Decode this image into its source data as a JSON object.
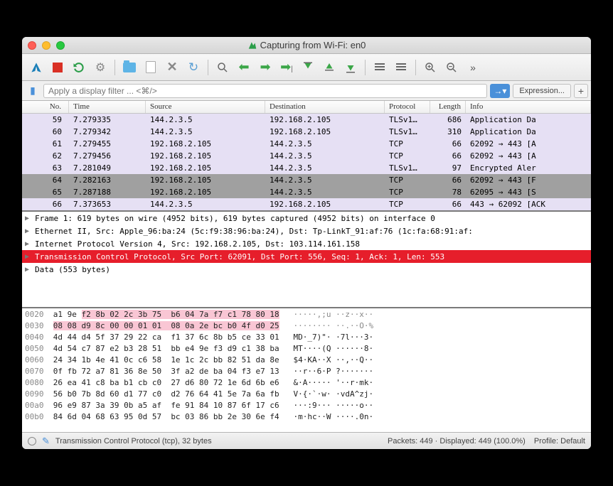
{
  "window": {
    "title": "Capturing from Wi-Fi: en0"
  },
  "filter": {
    "placeholder": "Apply a display filter ... <⌘/>",
    "expression_label": "Expression..."
  },
  "columns": {
    "no": "No.",
    "time": "Time",
    "src": "Source",
    "dst": "Destination",
    "proto": "Protocol",
    "len": "Length",
    "info": "Info"
  },
  "packets": [
    {
      "no": "59",
      "time": "7.279335",
      "src": "144.2.3.5",
      "dst": "192.168.2.105",
      "proto": "TLSv1…",
      "len": "686",
      "info": "Application Da",
      "bg": "#e6e0f4"
    },
    {
      "no": "60",
      "time": "7.279342",
      "src": "144.2.3.5",
      "dst": "192.168.2.105",
      "proto": "TLSv1…",
      "len": "310",
      "info": "Application Da",
      "bg": "#e6e0f4"
    },
    {
      "no": "61",
      "time": "7.279455",
      "src": "192.168.2.105",
      "dst": "144.2.3.5",
      "proto": "TCP",
      "len": "66",
      "info": "62092 → 443  [A",
      "bg": "#e6e0f4"
    },
    {
      "no": "62",
      "time": "7.279456",
      "src": "192.168.2.105",
      "dst": "144.2.3.5",
      "proto": "TCP",
      "len": "66",
      "info": "62092 → 443  [A",
      "bg": "#e6e0f4"
    },
    {
      "no": "63",
      "time": "7.281049",
      "src": "192.168.2.105",
      "dst": "144.2.3.5",
      "proto": "TLSv1…",
      "len": "97",
      "info": "Encrypted Aler",
      "bg": "#e6e0f4"
    },
    {
      "no": "64",
      "time": "7.282163",
      "src": "192.168.2.105",
      "dst": "144.2.3.5",
      "proto": "TCP",
      "len": "66",
      "info": "62092 → 443  [F",
      "bg": "#a0a0a0"
    },
    {
      "no": "65",
      "time": "7.287188",
      "src": "192.168.2.105",
      "dst": "144.2.3.5",
      "proto": "TCP",
      "len": "78",
      "info": "62095 → 443  [S",
      "bg": "#a0a0a0"
    },
    {
      "no": "66",
      "time": "7.373653",
      "src": "144.2.3.5",
      "dst": "192.168.2.105",
      "proto": "TCP",
      "len": "66",
      "info": "443 → 62092  [ACK",
      "bg": "#e6e0f4"
    }
  ],
  "details": [
    {
      "text": "Frame 1: 619 bytes on wire (4952 bits), 619 bytes captured (4952 bits) on interface 0",
      "sel": false
    },
    {
      "text": "Ethernet II, Src: Apple_96:ba:24 (5c:f9:38:96:ba:24), Dst: Tp-LinkT_91:af:76 (1c:fa:68:91:af:",
      "sel": false
    },
    {
      "text": "Internet Protocol Version 4, Src: 192.168.2.105, Dst: 103.114.161.158",
      "sel": false
    },
    {
      "text": "Transmission Control Protocol, Src Port: 62091, Dst Port: 556, Seq: 1, Ack: 1, Len: 553",
      "sel": true
    },
    {
      "text": "Data (553 bytes)",
      "sel": false
    }
  ],
  "hex": [
    {
      "off": "0020",
      "b1": "a1 9e ",
      "hl": "f2 8b 02 2c 3b 75  b6 04 7a f7 c1 78 80 18",
      "b2": "",
      "asc": "   ·····,;u ··z··x··",
      "asc_on": false
    },
    {
      "off": "0030",
      "b1": "",
      "hl": "08 08 d9 8c 00 00 01 01  08 0a 2e bc b0 4f d0 25",
      "b2": "",
      "asc": "   ········ ··.··O·%",
      "asc_on": false
    },
    {
      "off": "0040",
      "b1": "",
      "hl": "",
      "b2": "4d 44 d4 5f 37 29 22 ca  f1 37 6c 8b b5 ce 33 01",
      "asc": "   MD·_7)\"· ·7l···3·",
      "asc_on": true
    },
    {
      "off": "0050",
      "b1": "",
      "hl": "",
      "b2": "4d 54 c7 87 e2 b3 28 51  bb e4 9e f3 d9 c1 38 ba",
      "asc": "   MT····(Q ······8·",
      "asc_on": true
    },
    {
      "off": "0060",
      "b1": "",
      "hl": "",
      "b2": "24 34 1b 4e 41 0c c6 58  1e 1c 2c bb 82 51 da 8e",
      "asc": "   $4·KA··X ··,··Q··",
      "asc_on": true
    },
    {
      "off": "0070",
      "b1": "",
      "hl": "",
      "b2": "0f fb 72 a7 81 36 8e 50  3f a2 de ba 04 f3 e7 13",
      "asc": "   ··r··6·P ?·······",
      "asc_on": true
    },
    {
      "off": "0080",
      "b1": "",
      "hl": "",
      "b2": "26 ea 41 c8 ba b1 cb c0  27 d6 80 72 1e 6d 6b e6",
      "asc": "   &·A····· '··r·mk·",
      "asc_on": true
    },
    {
      "off": "0090",
      "b1": "",
      "hl": "",
      "b2": "56 b0 7b 8d 60 d1 77 c0  d2 76 64 41 5e 7a 6a fb",
      "asc": "   V·{·`·w· ·vdA^zj·",
      "asc_on": true
    },
    {
      "off": "00a0",
      "b1": "",
      "hl": "",
      "b2": "96 e9 87 3a 39 0b a5 af  fe 91 84 10 87 6f 17 c6",
      "asc": "   ···:9··· ·····o··",
      "asc_on": true
    },
    {
      "off": "00b0",
      "b1": "",
      "hl": "",
      "b2": "84 6d 04 68 63 95 0d 57  bc 03 86 bb 2e 30 6e f4",
      "asc": "   ·m·hc··W ····.0n·",
      "asc_on": true
    }
  ],
  "status": {
    "detail": "Transmission Control Protocol (tcp), 32 bytes",
    "packets": "Packets: 449 · Displayed: 449 (100.0%)",
    "profile": "Profile: Default"
  }
}
